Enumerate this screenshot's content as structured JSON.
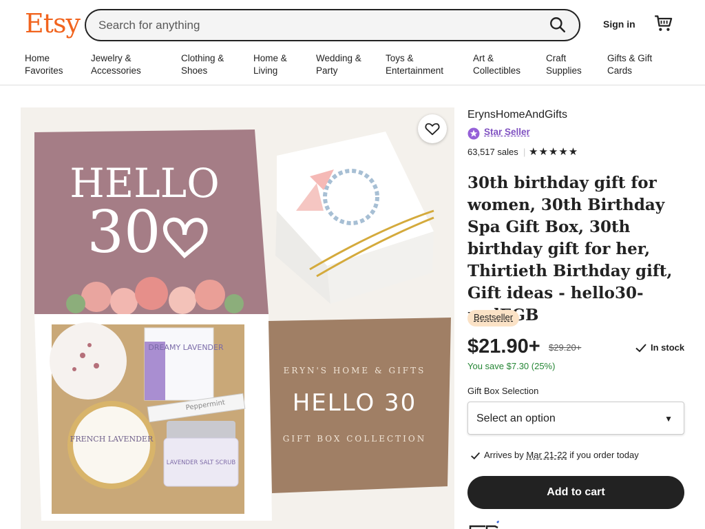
{
  "header": {
    "logo": "Etsy",
    "search_placeholder": "Search for anything",
    "signin_label": "Sign in",
    "brand_color": "#f1641e"
  },
  "nav": [
    {
      "line1": "Home",
      "line2": "Favorites"
    },
    {
      "line1": "Jewelry &",
      "line2": "Accessories"
    },
    {
      "line1": "Clothing &",
      "line2": "Shoes"
    },
    {
      "line1": "Home &",
      "line2": "Living"
    },
    {
      "line1": "Wedding &",
      "line2": "Party"
    },
    {
      "line1": "Toys &",
      "line2": "Entertainment"
    },
    {
      "line1": "Art &",
      "line2": "Collectibles"
    },
    {
      "line1": "Craft",
      "line2": "Supplies"
    },
    {
      "line1": "Gifts & Gift",
      "line2": "Cards"
    }
  ],
  "gallery": {
    "lid_text_line1": "HELLO",
    "lid_text_line2": "30",
    "card_line1": "ERYN'S HOME & GIFTS",
    "card_line2": "HELLO 30",
    "card_line3": "GIFT BOX COLLECTION",
    "soap_label": "DREAMY LAVENDER",
    "candle_label": "FRENCH LAVENDER",
    "scrub_label": "LAVENDER SALT SCRUB",
    "lip_label": "Peppermint"
  },
  "product": {
    "shop_name": "ErynsHomeAndGifts",
    "star_seller_label": "Star Seller",
    "sales": "63,517 sales",
    "separator": "|",
    "rating_stars": "★★★★★",
    "title": "30th birthday gift for women, 30th Birthday Spa Gift Box, 30th birthday gift for her, Thirtieth Birthday gift, Gift ideas - hello30-ncdEGB",
    "bestseller_label": "Bestseller",
    "price": "$21.90+",
    "original_price": "$29.20+",
    "stock_label": "In stock",
    "savings": "You save $7.30 (25%)",
    "option_label": "Gift Box Selection",
    "option_value": "Select an option",
    "arrives_prefix": "Arrives by ",
    "arrives_date": "Mar 21-22",
    "arrives_suffix": " if you order today",
    "add_to_cart_label": "Add to cart",
    "accent_color": "#7f50c1",
    "savings_color": "#258635"
  }
}
